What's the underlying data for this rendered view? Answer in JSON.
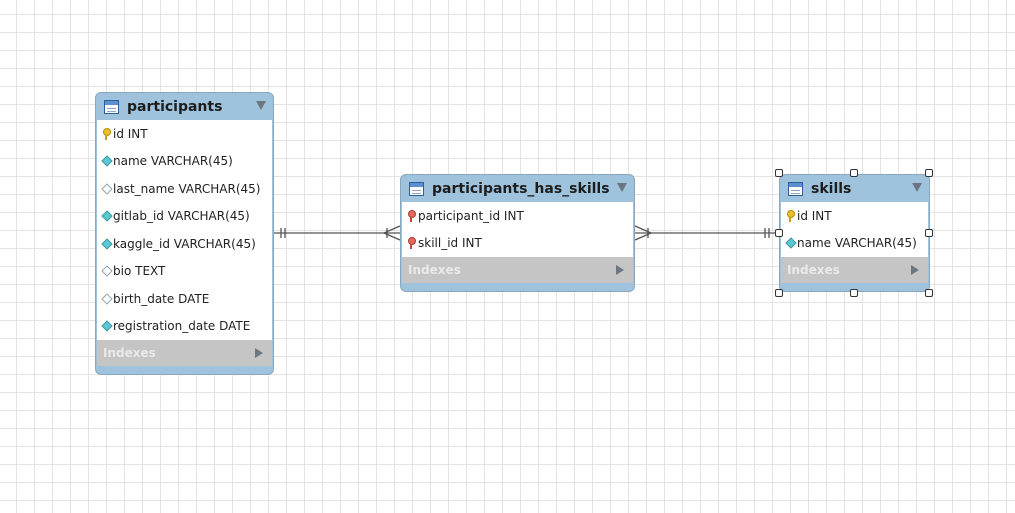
{
  "tables": [
    {
      "name": "participants",
      "columns": [
        {
          "kind": "pk",
          "label": "id INT"
        },
        {
          "kind": "nn",
          "label": "name VARCHAR(45)"
        },
        {
          "kind": "col",
          "label": "last_name VARCHAR(45)"
        },
        {
          "kind": "nn",
          "label": "gitlab_id VARCHAR(45)"
        },
        {
          "kind": "nn",
          "label": "kaggle_id VARCHAR(45)"
        },
        {
          "kind": "col",
          "label": "bio TEXT"
        },
        {
          "kind": "col",
          "label": "birth_date DATE"
        },
        {
          "kind": "nn",
          "label": "registration_date DATE"
        }
      ],
      "indexes_label": "Indexes"
    },
    {
      "name": "participants_has_skills",
      "columns": [
        {
          "kind": "fk",
          "label": "participant_id INT"
        },
        {
          "kind": "fk",
          "label": "skill_id INT"
        }
      ],
      "indexes_label": "Indexes"
    },
    {
      "name": "skills",
      "columns": [
        {
          "kind": "pk",
          "label": "id INT"
        },
        {
          "kind": "nn",
          "label": "name VARCHAR(45)"
        }
      ],
      "indexes_label": "Indexes",
      "selected": true
    }
  ],
  "relationships": [
    {
      "from": "participants",
      "to": "participants_has_skills",
      "from_cardinality": "one-mandatory",
      "to_cardinality": "many-mandatory"
    },
    {
      "from": "participants_has_skills",
      "to": "skills",
      "from_cardinality": "many-mandatory",
      "to_cardinality": "one-mandatory"
    }
  ],
  "colors": {
    "table_header": "#9fc3dd",
    "indexes_bar": "#c5c5c5",
    "canvas_grid": "#e4e4e4",
    "connector": "#555555"
  }
}
